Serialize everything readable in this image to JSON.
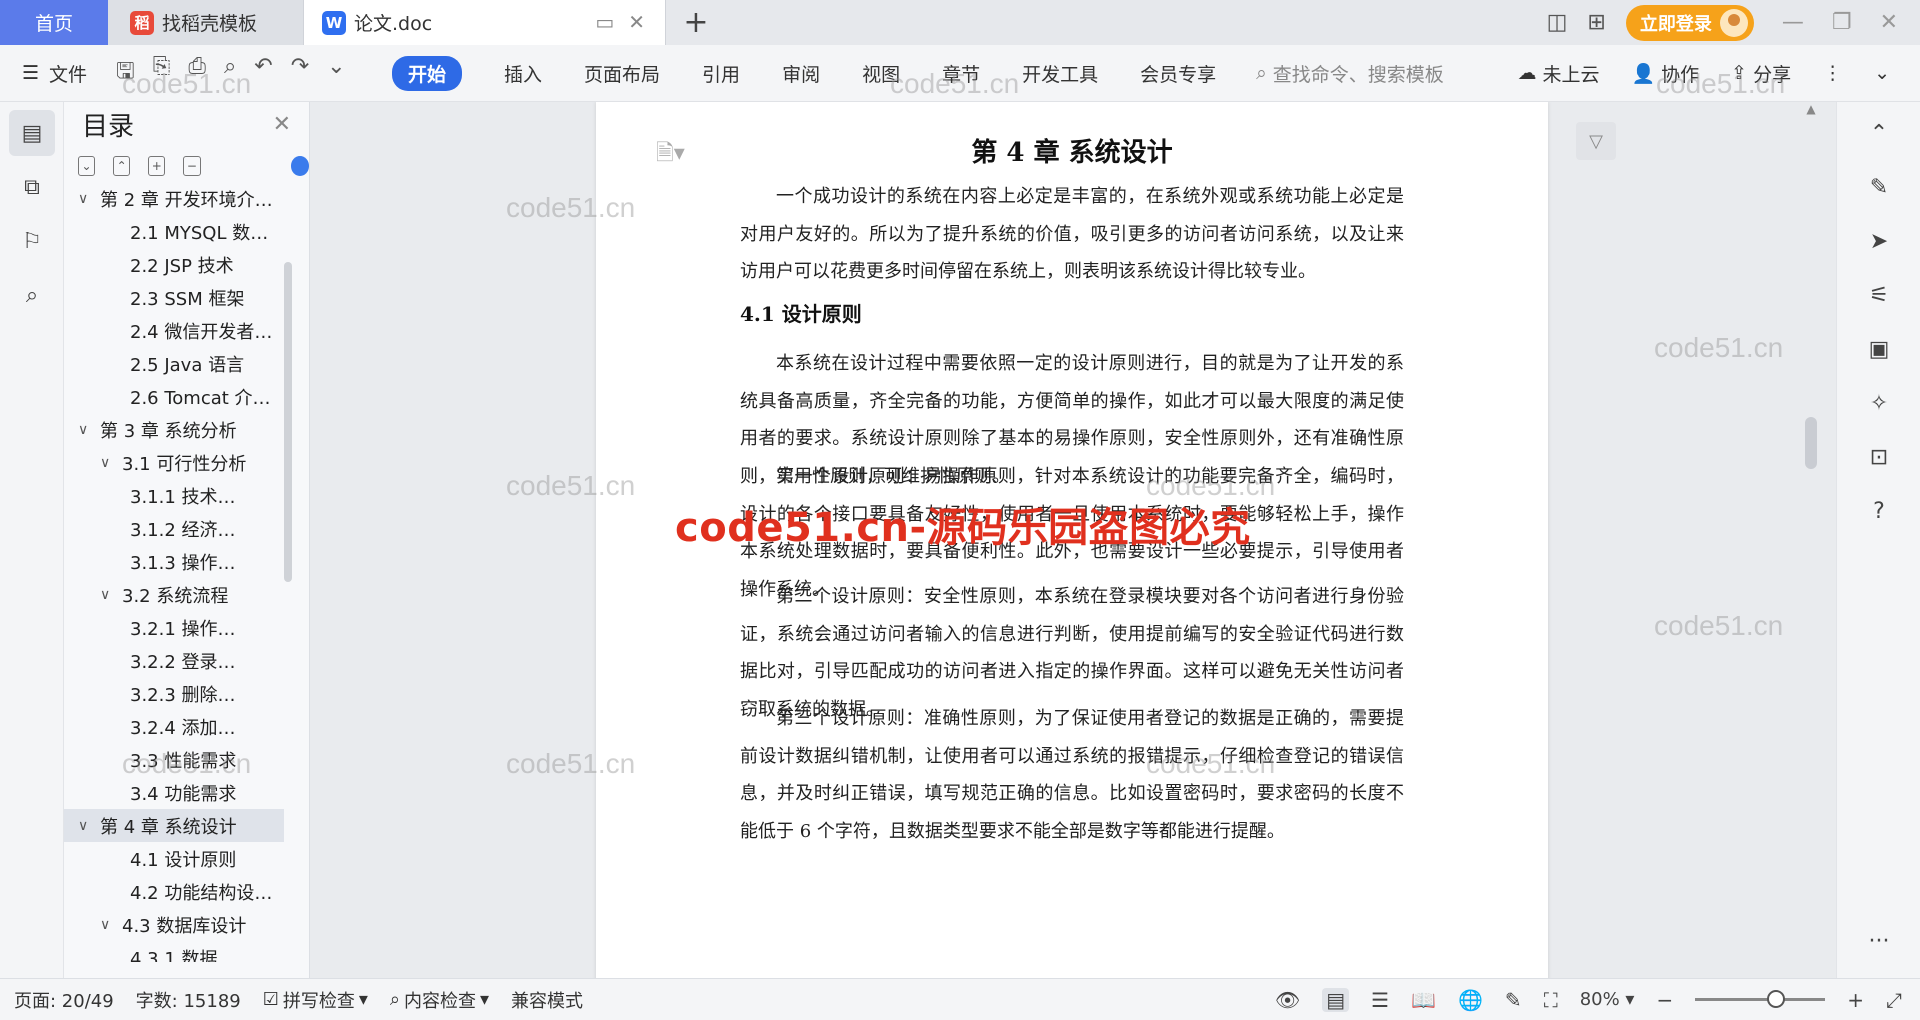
{
  "tabs": {
    "home": "首页",
    "docer": "找稻壳模板",
    "active_doc": "论文.doc"
  },
  "title_right": {
    "login": "立即登录"
  },
  "toolbar": {
    "file": "文件",
    "ribbon": [
      "开始",
      "插入",
      "页面布局",
      "引用",
      "审阅",
      "视图",
      "章节",
      "开发工具",
      "会员专享"
    ],
    "active_ribbon": "开始",
    "search_placeholder": "查找命令、搜索模板",
    "cloud": "未上云",
    "collab": "协作",
    "share": "分享"
  },
  "toc": {
    "title": "目录",
    "items": [
      {
        "label": "第 2 章 开发环境介…",
        "level": 1,
        "chev": "∨"
      },
      {
        "label": "2.1 MYSQL 数…",
        "level": 2,
        "chev": ""
      },
      {
        "label": "2.2 JSP 技术",
        "level": 2,
        "chev": ""
      },
      {
        "label": "2.3 SSM 框架",
        "level": 2,
        "chev": ""
      },
      {
        "label": "2.4 微信开发者…",
        "level": 2,
        "chev": ""
      },
      {
        "label": "2.5 Java 语言",
        "level": 2,
        "chev": ""
      },
      {
        "label": "2.6 Tomcat 介…",
        "level": 2,
        "chev": ""
      },
      {
        "label": "第 3 章 系统分析",
        "level": 1,
        "chev": "∨"
      },
      {
        "label": "3.1 可行性分析",
        "level": 2,
        "chev": "∨"
      },
      {
        "label": "3.1.1 技术…",
        "level": 3,
        "chev": ""
      },
      {
        "label": "3.1.2 经济…",
        "level": 3,
        "chev": ""
      },
      {
        "label": "3.1.3 操作…",
        "level": 3,
        "chev": ""
      },
      {
        "label": "3.2 系统流程",
        "level": 2,
        "chev": "∨"
      },
      {
        "label": "3.2.1 操作…",
        "level": 3,
        "chev": ""
      },
      {
        "label": "3.2.2 登录…",
        "level": 3,
        "chev": ""
      },
      {
        "label": "3.2.3 删除…",
        "level": 3,
        "chev": ""
      },
      {
        "label": "3.2.4 添加…",
        "level": 3,
        "chev": ""
      },
      {
        "label": "3.3 性能需求",
        "level": 2,
        "chev": ""
      },
      {
        "label": "3.4 功能需求",
        "level": 2,
        "chev": ""
      },
      {
        "label": "第 4 章  系统设计",
        "level": 1,
        "chev": "∨",
        "selected": true
      },
      {
        "label": "4.1 设计原则",
        "level": 2,
        "chev": ""
      },
      {
        "label": "4.2 功能结构设…",
        "level": 2,
        "chev": ""
      },
      {
        "label": "4.3 数据库设计",
        "level": 2,
        "chev": "∨"
      },
      {
        "label": "4.3.1 数据…",
        "level": 3,
        "chev": ""
      }
    ]
  },
  "document": {
    "chapter_title": "第 4 章  系统设计",
    "intro": "一个成功设计的系统在内容上必定是丰富的，在系统外观或系统功能上必定是对用户友好的。所以为了提升系统的价值，吸引更多的访问者访问系统，以及让来访用户可以花费更多时间停留在系统上，则表明该系统设计得比较专业。",
    "section_title": "4.1  设计原则",
    "p1": "本系统在设计过程中需要依照一定的设计原则进行，目的就是为了让开发的系统具备高质量，齐全完备的功能，方便简单的操作，如此才可以最大限度的满足使用者的要求。系统设计原则除了基本的易操作原则，安全性原则外，还有准确性原则，实用性原则，可维护性原则。",
    "p2": "第一个设计原则：易操作原则，针对本系统设计的功能要完备齐全，编码时，设计的各个接口要具备友好性，使用者一旦使用本系统时，要能够轻松上手，操作本系统处理数据时，要具备便利性。此外，也需要设计一些必要提示，引导使用者操作系统。",
    "p3": "第二个设计原则：安全性原则，本系统在登录模块要对各个访问者进行身份验证，系统会通过访问者输入的信息进行判断，使用提前编写的安全验证代码进行数据比对，引导匹配成功的访问者进入指定的操作界面。这样可以避免无关性访问者窃取系统的数据。",
    "p4": "第三个设计原则：准确性原则，为了保证使用者登记的数据是正确的，需要提前设计数据纠错机制，让使用者可以通过系统的报错提示，仔细检查登记的错误信息，并及时纠正错误，填写规范正确的信息。比如设置密码时，要求密码的长度不能低于 6 个字符，且数据类型要求不能全部是数字等都能进行提醒。"
  },
  "watermarks": {
    "small": "code51.cn",
    "big": "code51.cn-源码乐园盗图必究"
  },
  "statusbar": {
    "page": "页面: 20/49",
    "words": "字数: 15189",
    "spell": "拼写检查",
    "content": "内容检查",
    "compat": "兼容模式",
    "zoom": "80%"
  }
}
